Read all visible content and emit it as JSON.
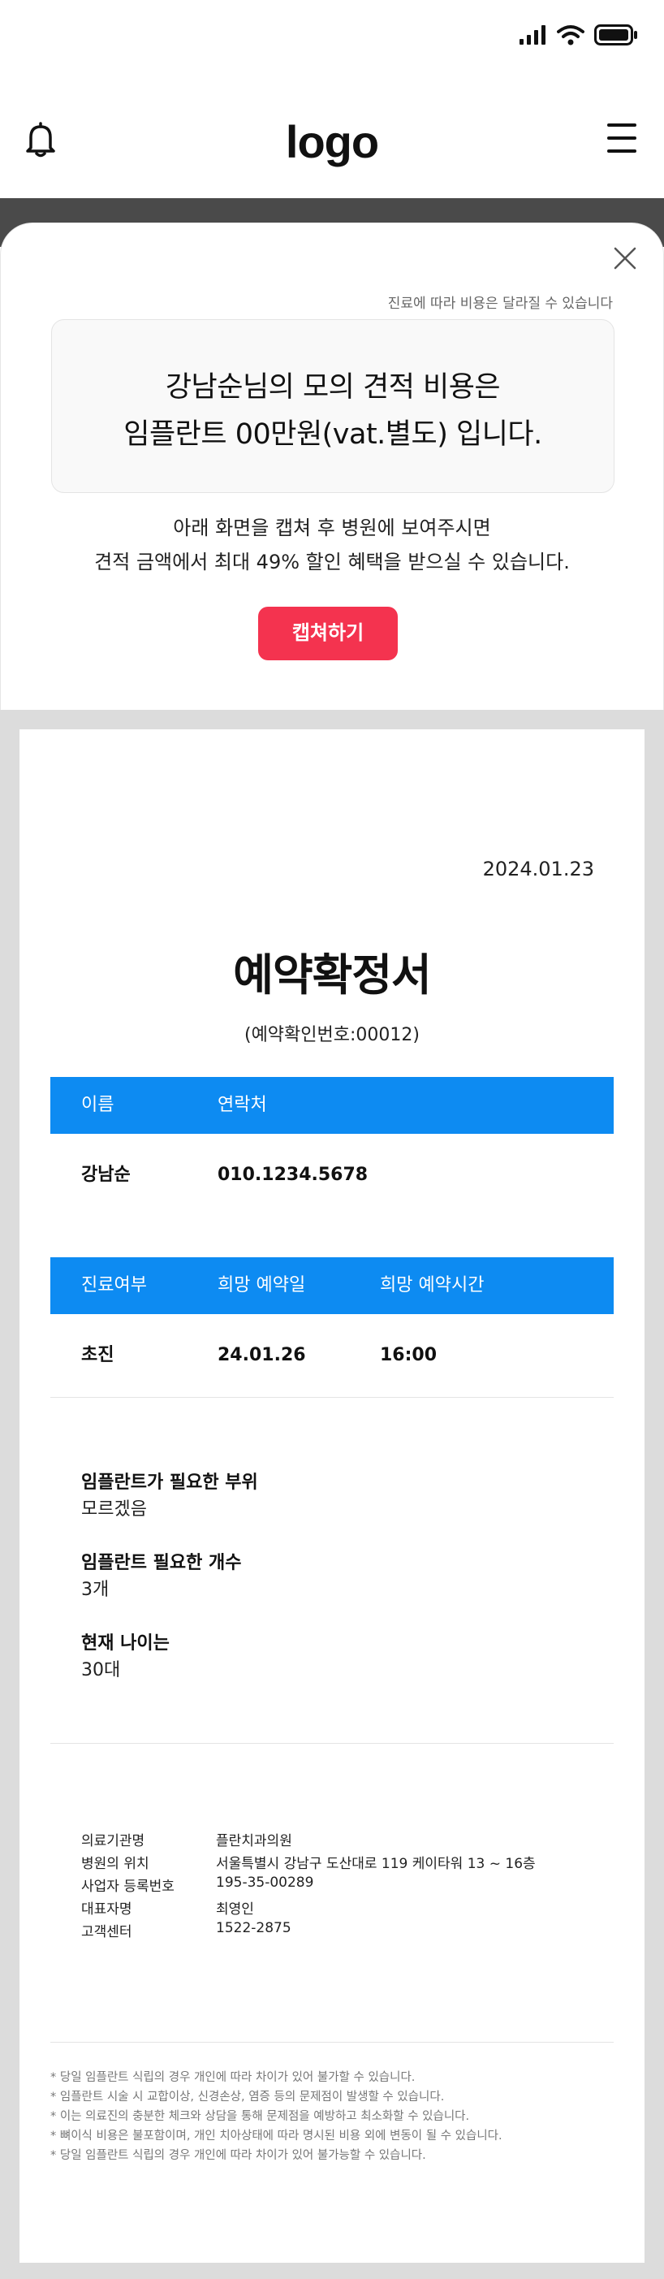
{
  "app": {
    "logo": "logo"
  },
  "modal": {
    "cost_notice": "진료에 따라 비용은 달라질 수 있습니다",
    "estimate_line1": "강남순님의 모의 견적 비용은",
    "estimate_line2": "임플란트 00만원(vat.별도) 입니다.",
    "desc_line1": "아래 화면을 캡쳐 후 병원에 보여주시면",
    "desc_line2": "견적 금액에서 최대 49% 할인 혜택을 받으실 수 있습니다.",
    "capture_button": "캡쳐하기"
  },
  "document": {
    "date": "2024.01.23",
    "title": "예약확정서",
    "confirm_number": "(예약확인번호:00012)",
    "contact_table": {
      "headers": [
        "이름",
        "연락처"
      ],
      "row": [
        "강남순",
        "010.1234.5678"
      ]
    },
    "visit_table": {
      "headers": [
        "진료여부",
        "희망 예약일",
        "희망 예약시간"
      ],
      "row": [
        "초진",
        "24.01.26",
        "16:00"
      ]
    },
    "questions": [
      {
        "q": "임플란트가 필요한 부위",
        "a": "모르겠음"
      },
      {
        "q": "임플란트 필요한 개수",
        "a": "3개"
      },
      {
        "q": "현재 나이는",
        "a": "30대"
      }
    ],
    "clinic_info": [
      {
        "label": "의료기관명",
        "value": "플란치과의원"
      },
      {
        "label": "병원의 위치",
        "value": "서울특별시 강남구 도산대로 119 케이타워 13 ~ 16층"
      },
      {
        "label": "사업자 등록번호",
        "value": "195-35-00289"
      },
      {
        "label": "대표자명",
        "value": "최영인"
      },
      {
        "label": "고객센터",
        "value": "1522-2875"
      }
    ],
    "notes": [
      "* 당일 임플란트 식립의 경우 개인에 따라 차이가 있어 불가할 수 있습니다.",
      "* 임플란트 시술 시 교합이상, 신경손상, 염증 등의 문제점이 발생할 수 있습니다.",
      "* 이는 의료진의 충분한 체크와 상담을 통해 문제점을 예방하고 최소화할 수 있습니다.",
      "* 뼈이식 비용은 불포함이며, 개인 치아상태에 따라 명시된 비용 외에 변동이 될 수 있습니다.",
      "* 당일 임플란트 식립의 경우 개인에 따라 차이가 있어 불가능할 수 있습니다."
    ]
  },
  "colors": {
    "accent_blue": "#0d8bf2",
    "capture_red": "#f4334f",
    "page_gray": "#dcdcdc",
    "header_dark": "#4a4a4a"
  },
  "icons": [
    "signal-icon",
    "wifi-icon",
    "battery-icon",
    "bell-icon",
    "menu-icon",
    "close-icon"
  ]
}
